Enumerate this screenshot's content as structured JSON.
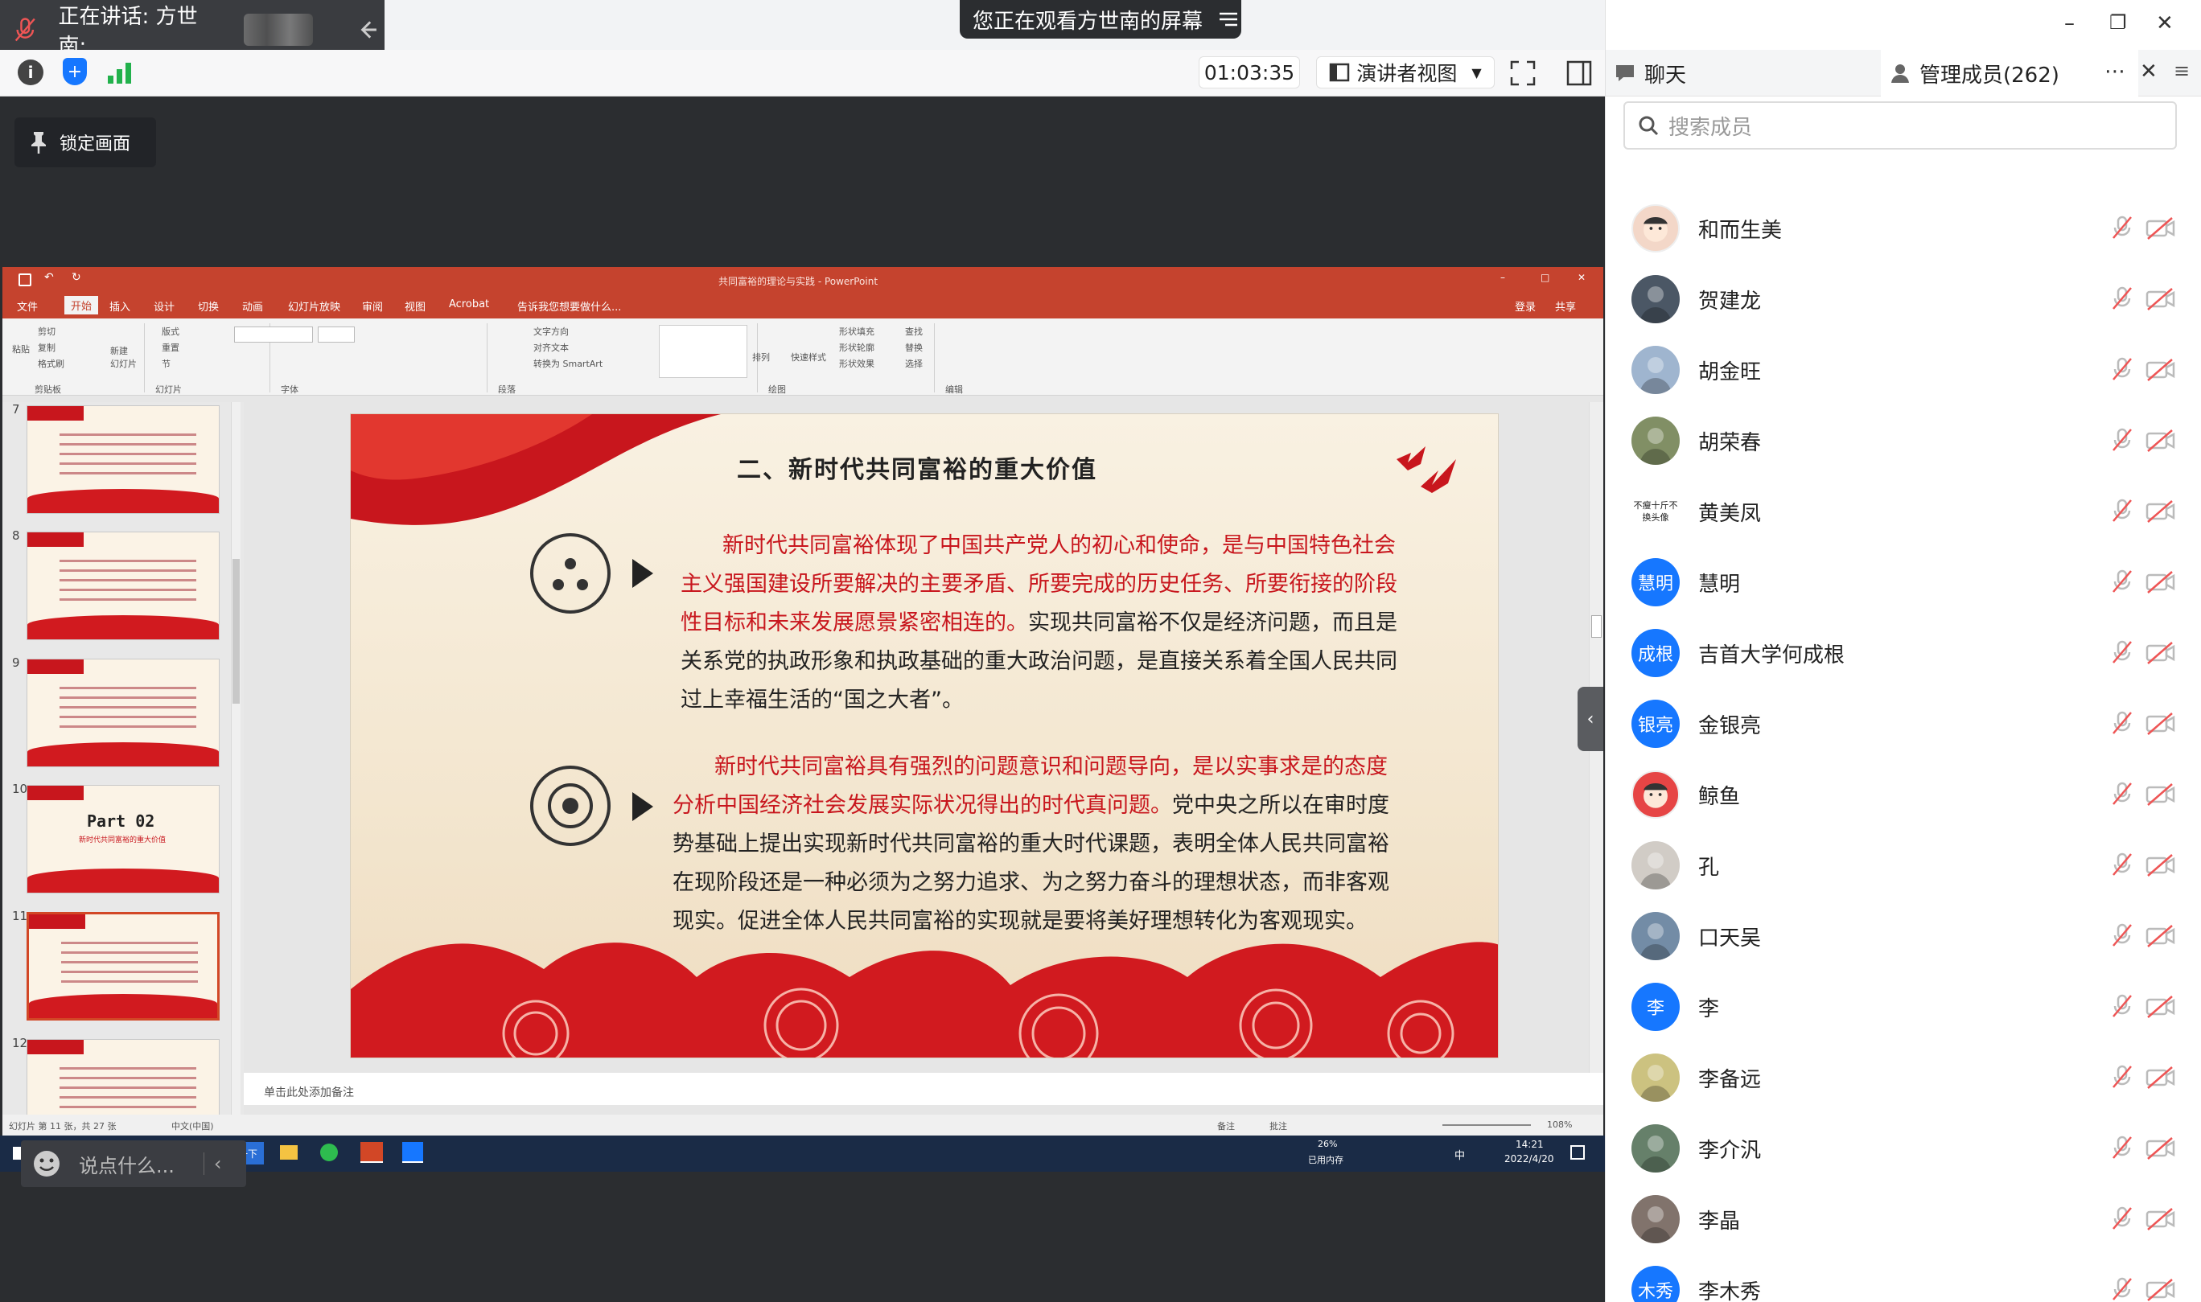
{
  "meeting": {
    "speaking": "正在讲话: 方世南;",
    "banner": "您正在观看方世南的屏幕",
    "timer": "01:03:35",
    "view_mode": "演讲者视图",
    "lock_label": "锁定画面",
    "chat_placeholder": "说点什么..."
  },
  "right_panel": {
    "tab_chat": "聊天",
    "tab_members": "管理成员(262)",
    "search_placeholder": "搜索成员",
    "members": [
      {
        "name": "和而生美",
        "avatar": "cartoon",
        "color": "#f3d7c8"
      },
      {
        "name": "贺建龙",
        "avatar": "photo",
        "color": "#2c3a4a"
      },
      {
        "name": "胡金旺",
        "avatar": "photo",
        "color": "#8fa9c7"
      },
      {
        "name": "胡荣春",
        "avatar": "photo",
        "color": "#6b7c4a"
      },
      {
        "name": "黄美凤",
        "avatar": "text",
        "avatar_text": "不瘦十斤不换头像",
        "color": "#ffffff"
      },
      {
        "name": "慧明",
        "avatar": "initials",
        "avatar_text": "慧明",
        "color": "#1677ff"
      },
      {
        "name": "吉首大学何成根",
        "avatar": "initials",
        "avatar_text": "成根",
        "color": "#1677ff"
      },
      {
        "name": "金银亮",
        "avatar": "initials",
        "avatar_text": "银亮",
        "color": "#1677ff"
      },
      {
        "name": "鲸鱼",
        "avatar": "cartoon",
        "color": "#e64545"
      },
      {
        "name": "孔",
        "avatar": "photo",
        "color": "#c9c3bd"
      },
      {
        "name": "口天吴",
        "avatar": "photo",
        "color": "#5b7897"
      },
      {
        "name": "李",
        "avatar": "initials",
        "avatar_text": "李",
        "color": "#1677ff"
      },
      {
        "name": "李备远",
        "avatar": "photo",
        "color": "#c3b86a"
      },
      {
        "name": "李介汎",
        "avatar": "photo",
        "color": "#4c6a50"
      },
      {
        "name": "李晶",
        "avatar": "photo",
        "color": "#6b5b53"
      },
      {
        "name": "李木秀",
        "avatar": "initials",
        "avatar_text": "木秀",
        "color": "#1677ff"
      }
    ]
  },
  "ppt": {
    "window_title": "共同富裕的理论与实践 - PowerPoint",
    "tabs": [
      "文件",
      "开始",
      "插入",
      "设计",
      "切换",
      "动画",
      "幻灯片放映",
      "审阅",
      "视图",
      "Acrobat"
    ],
    "tell_me": "告诉我您想要做什么...",
    "login": "登录",
    "share": "共享",
    "ribbon_groups": [
      "剪贴板",
      "幻灯片",
      "字体",
      "段落",
      "绘图",
      "编辑"
    ],
    "ribbon_items": {
      "paste": "粘贴",
      "cut": "剪切",
      "copy": "复制",
      "format_painter": "格式刷",
      "new_slide": "新建\n幻灯片",
      "layout": "版式",
      "reset": "重置",
      "section": "节",
      "text_dir": "文字方向",
      "align_text": "对齐文本",
      "smartart": "转换为 SmartArt",
      "arrange": "排列",
      "quick_style": "快速样式",
      "fill": "形状填充",
      "outline": "形状轮廓",
      "effect": "形状效果",
      "find": "查找",
      "replace": "替换",
      "select": "选择"
    },
    "thumb_numbers": [
      "7",
      "8",
      "9",
      "10",
      "11",
      "12"
    ],
    "thumb10_title": "Part 02",
    "thumb10_sub": "新时代共同富裕的重大价值",
    "notes": "单击此处添加备注",
    "status_left": "幻灯片 第 11 张，共 27 张",
    "status_lang": "中文(中国)",
    "status_notes": "备注",
    "status_comments": "批注",
    "zoom": "108%",
    "slide": {
      "title": "二、新时代共同富裕的重大价值",
      "p1_red": "新时代共同富裕体现了中国共产党人的初心和使命，是与中国特色社会主义强国建设所要解决的主要矛盾、所要完成的历史任务、所要衔接的阶段性目标和未来发展愿景紧密相连的。",
      "p1_black": "实现共同富裕不仅是经济问题，而且是关系党的执政形象和执政基础的重大政治问题，是直接关系着全国人民共同过上幸福生活的“国之大者”。",
      "p2_red": "新时代共同富裕具有强烈的问题意识和问题导向，是以实事求是的态度分析中国经济社会发展实际状况得出的时代真问题。",
      "p2_black": "党中央之所以在审时度势基础上提出实现新时代共同富裕的重大时代课题，表明全体人民共同富裕在现阶段还是一种必须为之努力追求、为之努力奋斗的理想状态，而非客观现实。促进全体人民共同富裕的实现就是要将美好理想转化为客观现实。"
    }
  },
  "taskbar": {
    "search": "搜索一下",
    "memory": "26%",
    "memory_label": "已用内存",
    "ime": "中",
    "time": "14:21",
    "date": "2022/4/20"
  },
  "colors": {
    "accent": "#1677ff",
    "ppt_red": "#c5432e",
    "slide_red": "#c8161d"
  }
}
